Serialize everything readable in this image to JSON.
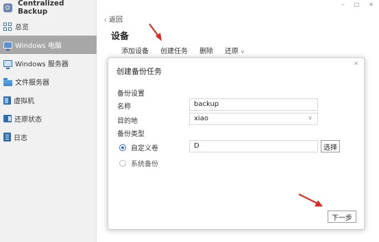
{
  "app": {
    "title": "Centralized Backup"
  },
  "sidebar": {
    "items": [
      {
        "label": "总览",
        "icon": "overview-grid-icon"
      },
      {
        "label": "Windows 电脑",
        "icon": "monitor-icon",
        "active": true
      },
      {
        "label": "Windows 服务器",
        "icon": "server-monitor-icon"
      },
      {
        "label": "文件服务器",
        "icon": "folder-icon"
      },
      {
        "label": "虚拟机",
        "icon": "virtual-machine-icon"
      },
      {
        "label": "还原状态",
        "icon": "restore-icon"
      },
      {
        "label": "日志",
        "icon": "log-icon"
      }
    ]
  },
  "window_controls": {
    "minimize": "–",
    "maximize": "□",
    "close": "×"
  },
  "main": {
    "back_label": "返回",
    "title": "设备",
    "toolbar": {
      "add": "添加设备",
      "create_task": "创建任务",
      "delete": "删除",
      "restore": "还原"
    }
  },
  "dialog": {
    "title": "创建备份任务",
    "close": "×",
    "section_backup_settings": "备份设置",
    "name_label": "名称",
    "name_value": "backup",
    "destination_label": "目的地",
    "destination_value": "xiao",
    "backup_type_label": "备份类型",
    "custom_volume_label": "自定义卷",
    "custom_volume_value": "D",
    "select_button": "选择",
    "system_backup_label": "系统备份",
    "next_button": "下一步"
  },
  "colors": {
    "accent": "#2d6cd0",
    "arrow": "#e0281e",
    "sidebar_active": "#a7a7a7"
  }
}
